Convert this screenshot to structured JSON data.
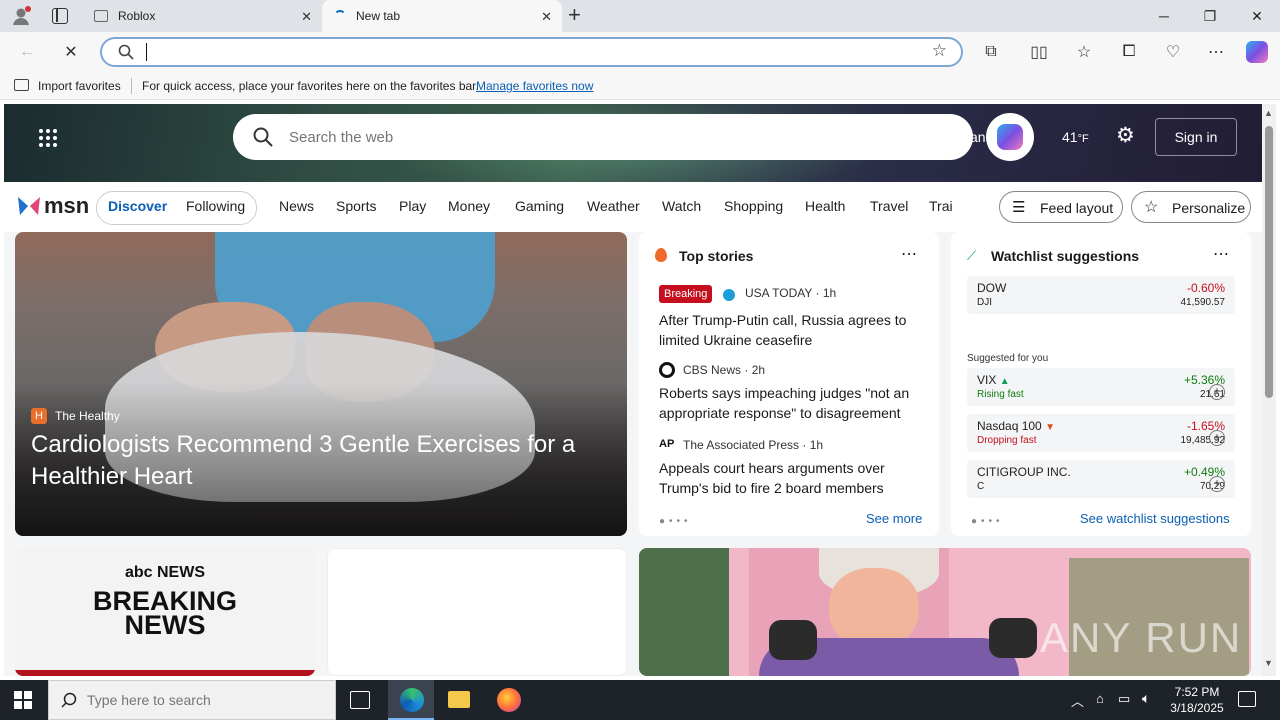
{
  "browser": {
    "tabs": [
      {
        "title": "Roblox"
      },
      {
        "title": "New tab"
      }
    ],
    "address_placeholder": "",
    "favorites_bar": {
      "import_label": "Import favorites",
      "hint": "For quick access, place your favorites here on the favorites bar.",
      "manage_link": "Manage favorites now"
    }
  },
  "msn": {
    "search_placeholder": "Search the web",
    "partial_text": "an",
    "weather": "41",
    "weather_unit": "°F",
    "sign_in": "Sign in",
    "logo_text": "msn",
    "nav": {
      "discover": "Discover",
      "following": "Following",
      "links": [
        "News",
        "Sports",
        "Play",
        "Money",
        "Gaming",
        "Weather",
        "Watch",
        "Shopping",
        "Health",
        "Travel",
        "Trai"
      ],
      "feed_layout": "Feed layout",
      "personalize": "Personalize"
    },
    "hero": {
      "source": "The Healthy",
      "headline": "Cardiologists Recommend 3 Gentle Exercises for a Healthier Heart"
    },
    "top_stories": {
      "title": "Top stories",
      "stories": [
        {
          "badge": "Breaking",
          "source": "USA TODAY",
          "time": "· 1h",
          "headline": "After Trump-Putin call, Russia agrees to limited Ukraine ceasefire"
        },
        {
          "source": "CBS News",
          "time": "· 2h",
          "headline": "Roberts says impeaching judges \"not an appropriate response\" to disagreement"
        },
        {
          "source": "The Associated Press",
          "time": "· 1h",
          "headline": "Appeals court hears arguments over Trump's bid to fire 2 board members"
        }
      ],
      "see_more": "See more"
    },
    "watchlist": {
      "title": "Watchlist suggestions",
      "suggested_label": "Suggested for you",
      "see_link": "See watchlist suggestions",
      "colors": {
        "up": "#0f7b0f",
        "down": "#c50f1f"
      },
      "dow": {
        "name": "DOW",
        "ticker": "DJI",
        "change": "-0.60%",
        "value": "41,590.57"
      },
      "stocks": [
        {
          "name": "VIX",
          "tag": "Rising fast",
          "change": "+5.36%",
          "value": "21.61"
        },
        {
          "name": "Nasdaq 100",
          "tag": "Dropping fast",
          "change": "-1.65%",
          "value": "19,485.92"
        },
        {
          "name": "CITIGROUP INC.",
          "ticker": "C",
          "change": "+0.49%",
          "value": "70.29"
        }
      ]
    },
    "abc_card": {
      "brand": "abc NEWS",
      "line1": "BREAKING",
      "line2": "NEWS"
    }
  },
  "watermark": "ANY RUN",
  "taskbar": {
    "search_placeholder": "Type here to search",
    "time": "7:52 PM",
    "date": "3/18/2025"
  }
}
